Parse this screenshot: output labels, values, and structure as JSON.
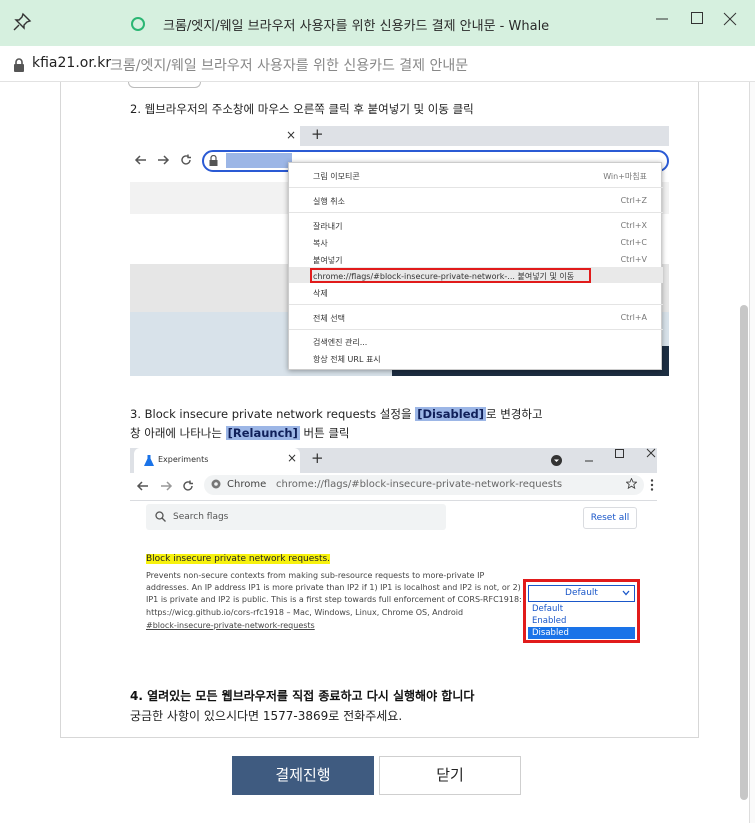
{
  "window": {
    "title": "크롬/엣지/웨일 브라우저 사용자를 위한 신용카드 결제 안내문 - Whale",
    "domain": "kfia21.or.kr",
    "page_title": "크롬/엣지/웨일 브라우저 사용자를 위한 신용카드 결제 안내문"
  },
  "steps": {
    "step2": "2. 웹브라우저의 주소창에 마우스 오른쪽 클릭 후 붙여넣기 및 이동 클릭",
    "step3_pre": "3. Block insecure private network requests 설정을 ",
    "step3_disabled": "[Disabled]",
    "step3_post": "로 변경하고",
    "step3b_pre": "창 아래에 나타나는 ",
    "step3b_relaunch": "[Relaunch]",
    "step3b_post": " 버튼 클릭",
    "step4": "4. 열려있는 모든 웹브라우저를 직접 종료하고 다시 실행해야 합니다",
    "contact": "궁금한 사항이 있으시다면 1577-3869로 전화주세요."
  },
  "shot1": {
    "tab_close": "×",
    "tab_plus": "+",
    "menu": [
      {
        "label": "그림 이모티콘",
        "shortcut": "Win+마침표"
      },
      {
        "label": "실행 취소",
        "shortcut": "Ctrl+Z"
      },
      {
        "label": "잘라내기",
        "shortcut": "Ctrl+X"
      },
      {
        "label": "복사",
        "shortcut": "Ctrl+C"
      },
      {
        "label": "붙여넣기",
        "shortcut": "Ctrl+V"
      },
      {
        "label": "chrome://flags/#block-insecure-private-network-... 붙여넣기 및 이동",
        "shortcut": ""
      },
      {
        "label": "삭제",
        "shortcut": ""
      },
      {
        "label": "전체 선택",
        "shortcut": "Ctrl+A"
      },
      {
        "label": "검색엔진 관리...",
        "shortcut": ""
      },
      {
        "label": "항상 전체 URL 표시",
        "shortcut": ""
      }
    ]
  },
  "shot2": {
    "tab_title": "Experiments",
    "tab_close": "×",
    "tab_plus": "+",
    "chrome_label": "Chrome",
    "url": "chrome://flags/#block-insecure-private-network-requests",
    "search_placeholder": "Search flags",
    "reset_label": "Reset all",
    "flag_title": "Block insecure private network requests.",
    "flag_desc": "Prevents non-secure contexts from making sub-resource requests to more-private IP addresses. An IP address IP1 is more private than IP2 if 1) IP1 is localhost and IP2 is not, or 2) IP1 is private and IP2 is public. This is a first step towards full enforcement of CORS-RFC1918: https://wicg.github.io/cors-rfc1918 – Mac, Windows, Linux, Chrome OS, Android",
    "flag_link": "#block-insecure-private-network-requests",
    "dropdown_value": "Default",
    "options": [
      "Default",
      "Enabled",
      "Disabled"
    ]
  },
  "buttons": {
    "pay": "결제진행",
    "close": "닫기"
  },
  "colors": {
    "titlebar": "#d6f0df",
    "pay_button": "#3f5b80",
    "highlight": "#9cb6e6",
    "red_box": "#e11b1b"
  }
}
